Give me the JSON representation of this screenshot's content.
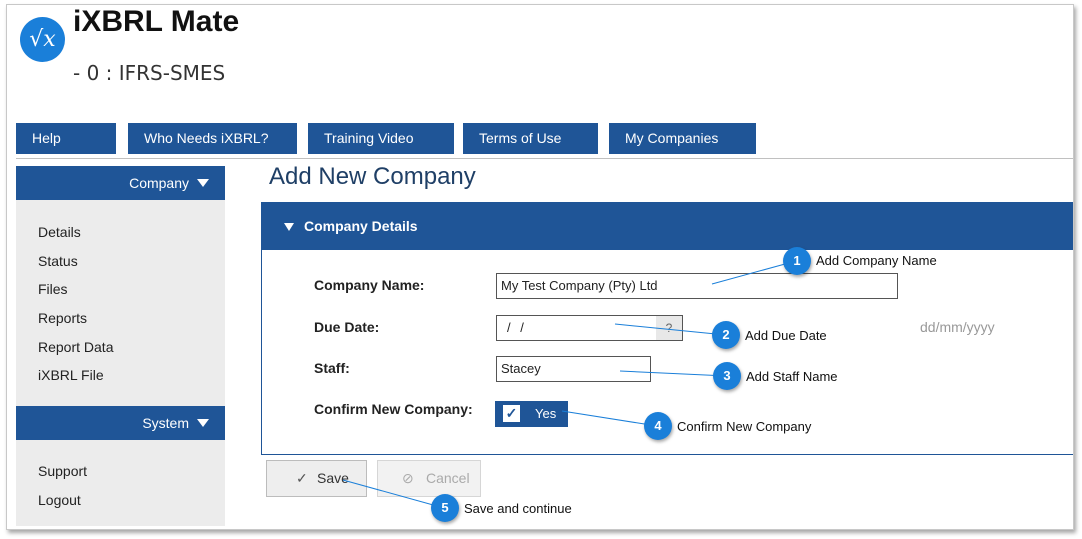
{
  "header": {
    "logo_glyph": "√x",
    "app_title": "iXBRL Mate",
    "subtitle": "- 0 : IFRS-SMES"
  },
  "nav": {
    "items": [
      "Help",
      "Who Needs iXBRL?",
      "Training Video",
      "Terms of Use",
      "My Companies"
    ]
  },
  "sidebar": {
    "company_label": "Company",
    "company_items": [
      "Details",
      "Status",
      "Files",
      "Reports",
      "Report Data",
      "iXBRL File"
    ],
    "system_label": "System",
    "system_items": [
      "Support",
      "Logout"
    ]
  },
  "main": {
    "page_title": "Add New Company",
    "panel_title": "Company Details",
    "company_name_label": "Company Name:",
    "company_name_value": "My Test Company (Pty) Ltd",
    "due_date_label": "Due Date:",
    "due_date_value": " /  /",
    "due_date_help": "?",
    "due_date_hint": "dd/mm/yyyy",
    "staff_label": "Staff:",
    "staff_value": "Stacey",
    "confirm_label": "Confirm New Company:",
    "confirm_value": "Yes",
    "confirm_check": "✓",
    "save_label": "Save",
    "cancel_label": "Cancel"
  },
  "callouts": [
    {
      "number": "1",
      "text": "Add Company Name"
    },
    {
      "number": "2",
      "text": "Add Due Date"
    },
    {
      "number": "3",
      "text": "Add Staff Name"
    },
    {
      "number": "4",
      "text": "Confirm New Company"
    },
    {
      "number": "5",
      "text": "Save and continue"
    }
  ],
  "colors": {
    "primary": "#1f5597",
    "callout": "#1a7fd9"
  }
}
